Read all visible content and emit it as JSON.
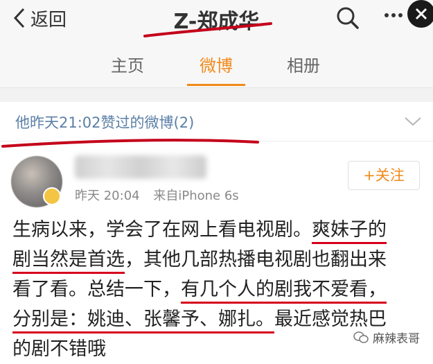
{
  "header": {
    "back_label": "返回",
    "title": "Z-郑成华"
  },
  "tabs": [
    {
      "label": "主页"
    },
    {
      "label": "微博"
    },
    {
      "label": "相册"
    }
  ],
  "active_tab": "微博",
  "liked_bar": {
    "text": "他昨天21:02赞过的微博(2)"
  },
  "post": {
    "time": "昨天 20:04",
    "source": "来自iPhone 6s",
    "follow_label": "+关注",
    "lines": [
      {
        "a": "生病以来，学会了在网上看电视剧。",
        "u": "爽妹子的"
      },
      {
        "u": "剧当然是首选",
        "a": "，其他几部热播电视剧也翻出来"
      },
      {
        "a": "看了看。总结一下，",
        "u": "有几个人的剧我不爱看，"
      },
      {
        "u": "分别是：姚迪、张馨予、娜扎。",
        "a": "最近感觉热巴"
      },
      {
        "a": "的剧不错哦"
      }
    ]
  },
  "watermark": {
    "text": "麻辣表哥"
  },
  "colors": {
    "accent": "#f08a1a",
    "link": "#5b7fa6",
    "annotation_red": "#d6001c"
  }
}
